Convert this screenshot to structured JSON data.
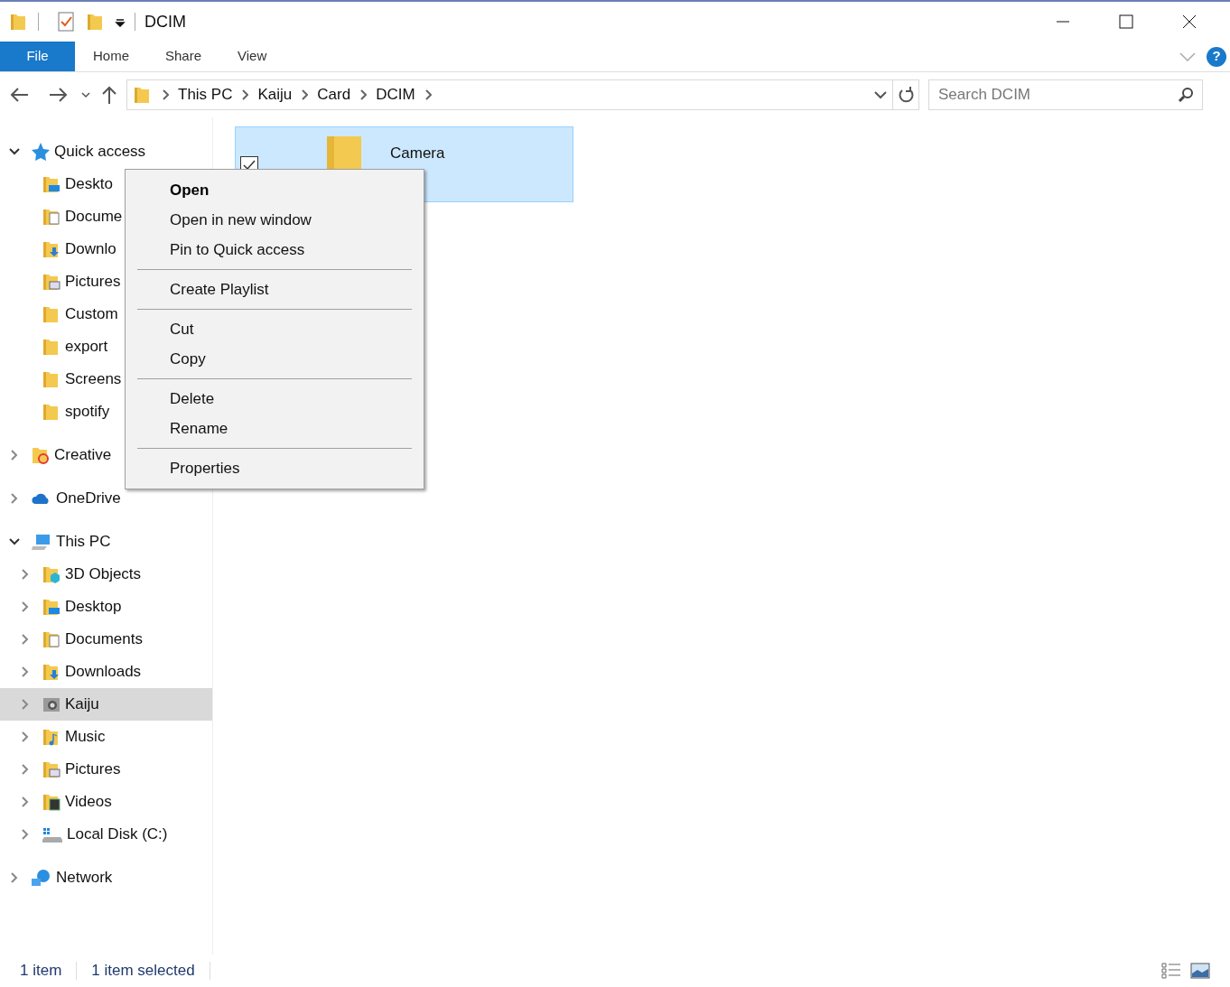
{
  "window": {
    "title": "DCIM"
  },
  "ribbon": {
    "tabs": [
      {
        "label": "File",
        "selected": true
      },
      {
        "label": "Home",
        "selected": false
      },
      {
        "label": "Share",
        "selected": false
      },
      {
        "label": "View",
        "selected": false
      }
    ],
    "help": "?"
  },
  "address": {
    "breadcrumbs": [
      "This PC",
      "Kaiju",
      "Card",
      "DCIM"
    ],
    "search": {
      "placeholder": "Search DCIM"
    }
  },
  "tree": [
    {
      "label": "Quick access",
      "kind": "star",
      "expanded": true,
      "selected": false,
      "children": [
        {
          "label": "Deskto",
          "kind": "desktop",
          "selected": false
        },
        {
          "label": "Docume",
          "kind": "documents",
          "selected": false
        },
        {
          "label": "Downlo",
          "kind": "downloads",
          "selected": false
        },
        {
          "label": "Pictures",
          "kind": "pictures",
          "selected": false
        },
        {
          "label": "Custom",
          "kind": "folder",
          "selected": false
        },
        {
          "label": "export",
          "kind": "folder",
          "selected": false
        },
        {
          "label": "Screens",
          "kind": "folder",
          "selected": false
        },
        {
          "label": "spotify",
          "kind": "folder",
          "selected": false
        }
      ]
    },
    {
      "label": "Creative",
      "kind": "creative",
      "expanded": false,
      "selected": false
    },
    {
      "label": "OneDrive",
      "kind": "cloud",
      "expanded": false,
      "selected": false
    },
    {
      "label": "This PC",
      "kind": "pc",
      "expanded": true,
      "selected": false,
      "children": [
        {
          "label": "3D Objects",
          "kind": "objects",
          "expanded": false,
          "selected": false
        },
        {
          "label": "Desktop",
          "kind": "desktop",
          "expanded": false,
          "selected": false
        },
        {
          "label": "Documents",
          "kind": "documents",
          "expanded": false,
          "selected": false
        },
        {
          "label": "Downloads",
          "kind": "downloads",
          "expanded": false,
          "selected": false
        },
        {
          "label": "Kaiju",
          "kind": "camera",
          "expanded": false,
          "selected": true
        },
        {
          "label": "Music",
          "kind": "music",
          "expanded": false,
          "selected": false
        },
        {
          "label": "Pictures",
          "kind": "pictures",
          "expanded": false,
          "selected": false
        },
        {
          "label": "Videos",
          "kind": "videos",
          "expanded": false,
          "selected": false
        },
        {
          "label": "Local Disk (C:)",
          "kind": "disk",
          "expanded": false,
          "selected": false
        }
      ]
    },
    {
      "label": "Network",
      "kind": "network",
      "expanded": false,
      "selected": false
    }
  ],
  "files": [
    {
      "name": "Camera",
      "selected": true,
      "checked": true
    }
  ],
  "context_menu": {
    "groups": [
      [
        {
          "label": "Open",
          "default": true
        },
        {
          "label": "Open in new window",
          "default": false
        },
        {
          "label": "Pin to Quick access",
          "default": false
        }
      ],
      [
        {
          "label": "Create Playlist",
          "default": false
        }
      ],
      [
        {
          "label": "Cut",
          "default": false
        },
        {
          "label": "Copy",
          "default": false
        }
      ],
      [
        {
          "label": "Delete",
          "default": false
        },
        {
          "label": "Rename",
          "default": false
        }
      ],
      [
        {
          "label": "Properties",
          "default": false
        }
      ]
    ]
  },
  "status_bar": {
    "count": "1 item",
    "selection": "1 item selected"
  }
}
